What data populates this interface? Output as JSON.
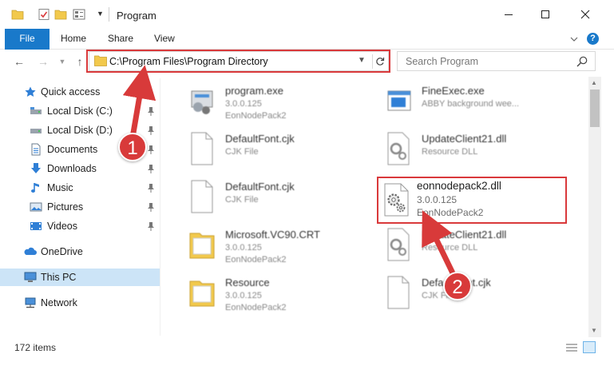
{
  "window": {
    "title": "Program",
    "controls": {
      "minimize_icon": "minimize-icon",
      "maximize_icon": "maximize-icon",
      "close_icon": "close-icon"
    }
  },
  "ribbon": {
    "tabs": [
      {
        "label": "File"
      },
      {
        "label": "Home"
      },
      {
        "label": "Share"
      },
      {
        "label": "View"
      }
    ]
  },
  "address_bar": {
    "path": "C:\\Program Files\\Program Directory",
    "search_placeholder": "Search Program"
  },
  "nav_pane": {
    "items": [
      {
        "label": "Quick access",
        "icon": "star-icon"
      },
      {
        "label": "Local Disk (C:)",
        "icon": "drive-icon",
        "pinned": true
      },
      {
        "label": "Local Disk (D:)",
        "icon": "drive-icon",
        "pinned": true
      },
      {
        "label": "Documents",
        "icon": "documents-icon",
        "pinned": true
      },
      {
        "label": "Downloads",
        "icon": "downloads-icon",
        "pinned": true
      },
      {
        "label": "Music",
        "icon": "music-icon",
        "pinned": true
      },
      {
        "label": "Pictures",
        "icon": "pictures-icon",
        "pinned": true
      },
      {
        "label": "Videos",
        "icon": "videos-icon",
        "pinned": true
      },
      {
        "label": "OneDrive",
        "icon": "onedrive-icon"
      },
      {
        "label": "This PC",
        "icon": "this-pc-icon",
        "selected": true
      },
      {
        "label": "Network",
        "icon": "network-icon"
      }
    ]
  },
  "files": [
    {
      "name": "program.exe",
      "line2": "3.0.0.125",
      "line3": "EonNodePack2",
      "icon": "exe-icon"
    },
    {
      "name": "FineExec.exe",
      "line2": "ABBY background wee...",
      "line3": "",
      "icon": "app-window-icon"
    },
    {
      "name": "DefaultFont.cjk",
      "line2": "CJK File",
      "line3": "",
      "icon": "blank-file-icon"
    },
    {
      "name": "UpdateClient21.dll",
      "line2": "Resource DLL",
      "line3": "",
      "icon": "dll-file-icon"
    },
    {
      "name": "DefaultFont.cjk",
      "line2": "CJK File",
      "line3": "",
      "icon": "blank-file-icon"
    },
    {
      "name": "eonnodepack2.dll",
      "line2": "3.0.0.125",
      "line3": "EonNodePack2",
      "icon": "dll-file-icon",
      "highlighted": true
    },
    {
      "name": "Microsoft.VC90.CRT",
      "line2": "3.0.0.125",
      "line3": "EonNodePack2",
      "icon": "folder-icon"
    },
    {
      "name": "UpdateClient21.dll",
      "line2": "Resource DLL",
      "line3": "",
      "icon": "dll-file-icon"
    },
    {
      "name": "Resource",
      "line2": "3.0.0.125",
      "line3": "EonNodePack2",
      "icon": "folder-icon"
    },
    {
      "name": "DefaultFont.cjk",
      "line2": "CJK File",
      "line3": "",
      "icon": "blank-file-icon"
    }
  ],
  "status": {
    "item_count": "172 items"
  },
  "callouts": [
    {
      "label": "1"
    },
    {
      "label": "2"
    }
  ],
  "colors": {
    "accent": "#1979ca",
    "highlight": "#d9393b",
    "selected_bg": "#cce4f7"
  }
}
